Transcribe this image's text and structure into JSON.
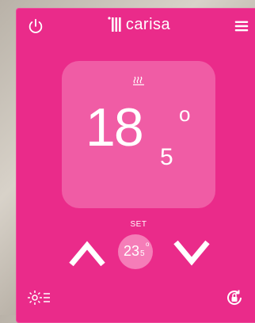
{
  "header": {
    "brand_name": "carisa",
    "power_icon": "power-icon",
    "menu_icon": "hamburger-menu-icon",
    "brand_icon": "carisa-logo-icon"
  },
  "current_temperature": {
    "integer": "18",
    "decimal": "5",
    "degree": "o",
    "heating_icon": "heating-icon"
  },
  "setpoint": {
    "label": "SET",
    "integer": "23",
    "decimal": "5",
    "degree": "o",
    "increase_icon": "chevron-up-icon",
    "decrease_icon": "chevron-down-icon"
  },
  "footer": {
    "settings_icon": "settings-list-icon",
    "lock_icon": "lock-rotate-icon"
  },
  "colors": {
    "panel": "#ea2b8a",
    "card": "#f05ca5",
    "setpoint_circle": "#f57db8",
    "foreground": "#ffffff"
  }
}
